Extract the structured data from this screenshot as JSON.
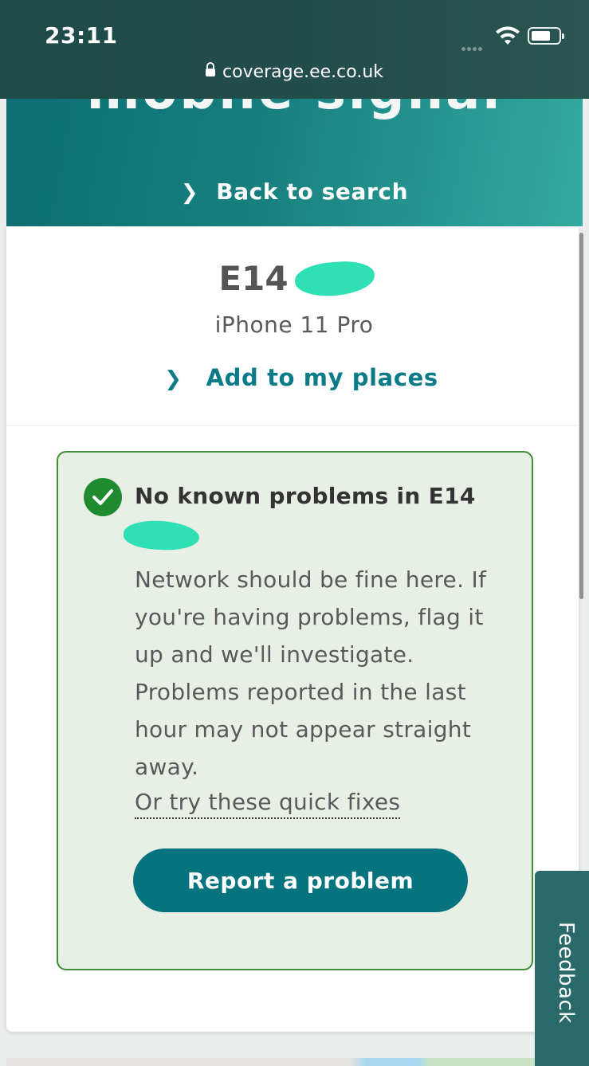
{
  "status_bar": {
    "time": "23:11",
    "url": "coverage.ee.co.uk",
    "icons": [
      "cellular-signal-icon",
      "wifi-icon",
      "battery-icon",
      "lock-icon"
    ]
  },
  "hero": {
    "title_partial": "mobile signal",
    "back_label": "Back to search"
  },
  "location": {
    "postcode": "E14",
    "device": "iPhone 11 Pro",
    "add_places_label": "Add to my places"
  },
  "status": {
    "title": "No known problems in E14",
    "body": "Network should be fine here. If you're having problems, flag it up and we'll investigate. Problems reported in the last hour may not appear straight away.",
    "quick_fixes_link": "Or try these quick fixes",
    "report_button": "Report a problem"
  },
  "feedback_tab": "Feedback",
  "colors": {
    "teal_primary": "#06747f",
    "link_teal": "#0a7b87",
    "ok_green": "#1f8a2e",
    "status_bg": "#e8f0e6",
    "status_border": "#3c8f31"
  }
}
